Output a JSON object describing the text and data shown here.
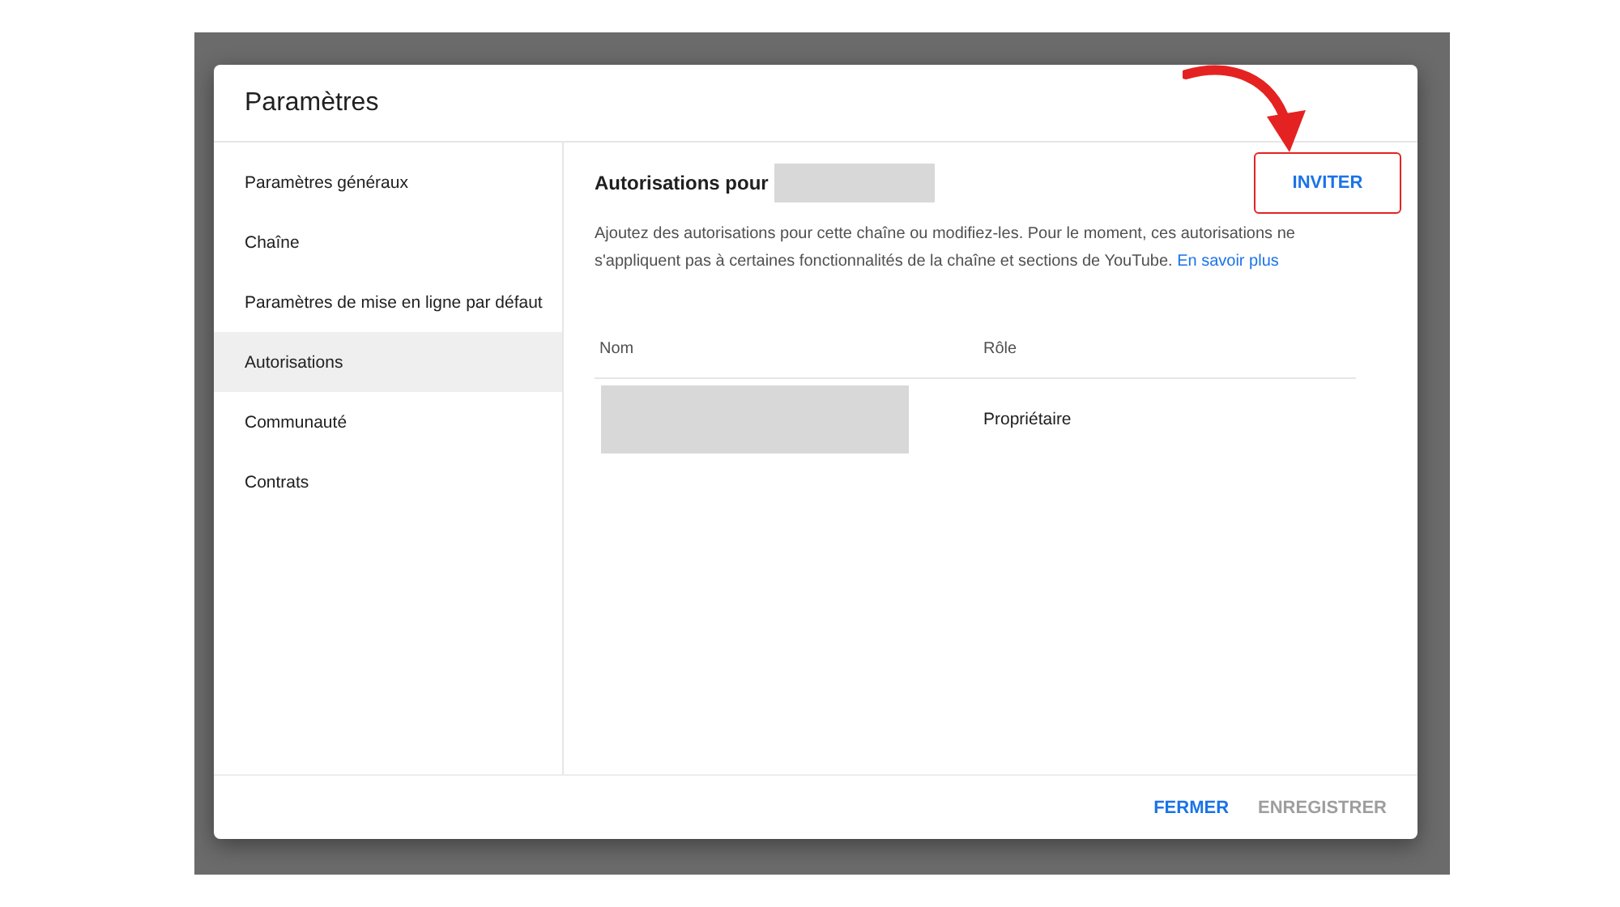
{
  "dialog": {
    "title": "Paramètres",
    "sidebar": {
      "items": [
        {
          "label": "Paramètres généraux",
          "selected": false
        },
        {
          "label": "Chaîne",
          "selected": false
        },
        {
          "label": "Paramètres de mise en ligne par défaut",
          "selected": false
        },
        {
          "label": "Autorisations",
          "selected": true
        },
        {
          "label": "Communauté",
          "selected": false
        },
        {
          "label": "Contrats",
          "selected": false
        }
      ]
    },
    "content": {
      "heading": "Autorisations pour",
      "invite_button": "INVITER",
      "description": "Ajoutez des autorisations pour cette chaîne ou modifiez-les. Pour le moment, ces autorisations ne s'appliquent pas à certaines fonctionnalités de la chaîne et sections de YouTube.",
      "learn_more_link": "En savoir plus",
      "table": {
        "columns": [
          "Nom",
          "Rôle"
        ],
        "rows": [
          {
            "role": "Propriétaire"
          }
        ]
      }
    },
    "footer": {
      "buttons": [
        {
          "label": "FERMER",
          "disabled": false
        },
        {
          "label": "ENREGISTRER",
          "disabled": true
        }
      ]
    }
  }
}
